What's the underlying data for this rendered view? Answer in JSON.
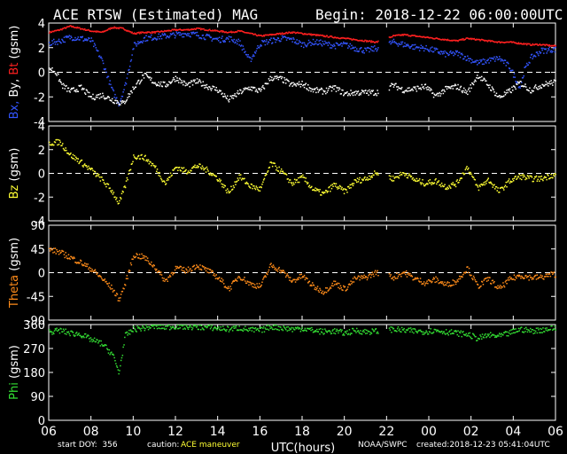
{
  "header": {
    "title": "ACE RTSW (Estimated) MAG",
    "begin": "Begin: 2018-12-22 06:00:00UTC"
  },
  "footer": {
    "start_doy": "start DOY:  356",
    "caution_label": "caution:",
    "caution_text": "ACE maneuver",
    "noaa": "NOAA/SWPC",
    "created": "created:2018-12-23 05:41:04UTC"
  },
  "colors": {
    "bx": "#3355ff",
    "by": "#ffffff",
    "bt": "#ff2020",
    "bz": "#ffff33",
    "theta": "#ff8c1a",
    "phi": "#33dd33"
  },
  "chart_data": [
    {
      "type": "scatter",
      "title": "ACE RTSW (Estimated) MAG",
      "ylabel_parts": [
        {
          "text": "Bx,",
          "color": "bx"
        },
        {
          "text": " By,",
          "color": "by"
        },
        {
          "text": " Bt",
          "color": "bt"
        },
        {
          "text": "  (gsm)",
          "color": "by"
        }
      ],
      "ylim": [
        -4,
        4
      ],
      "yticks": [
        4,
        2,
        0,
        -2,
        -4
      ],
      "series": [
        {
          "name": "Bt",
          "color": "bt",
          "x": [
            0,
            0.5,
            1,
            1.5,
            2,
            2.5,
            3,
            3.5,
            4,
            4.5,
            5,
            5.5,
            6,
            6.5,
            7,
            7.5,
            8,
            8.5,
            9,
            9.5,
            10,
            10.5,
            11,
            11.5,
            12,
            12.5,
            13,
            13.5,
            14,
            14.5,
            15,
            15.5,
            16.3,
            16.8,
            17.3,
            17.8,
            18.3,
            18.8,
            19.3,
            19.8,
            20.3,
            20.8,
            21.3,
            21.8,
            22.3,
            22.8,
            23.3,
            23.8
          ],
          "y": [
            3.3,
            3.5,
            3.8,
            3.6,
            3.4,
            3.3,
            3.7,
            3.6,
            3.2,
            3.3,
            3.3,
            3.4,
            3.5,
            3.5,
            3.6,
            3.5,
            3.4,
            3.3,
            3.4,
            3.2,
            3.0,
            3.1,
            3.2,
            3.3,
            3.2,
            3.1,
            3.0,
            2.9,
            2.8,
            2.7,
            2.6,
            2.5,
            3.0,
            3.1,
            3.0,
            2.9,
            2.8,
            2.7,
            2.6,
            2.8,
            2.7,
            2.6,
            2.5,
            2.5,
            2.4,
            2.3,
            2.3,
            2.2
          ]
        },
        {
          "name": "Bx",
          "color": "bx",
          "x": [
            0,
            0.5,
            1,
            1.5,
            2,
            2.5,
            3,
            3.3,
            3.6,
            4,
            4.5,
            5,
            5.5,
            6,
            6.5,
            7,
            7.5,
            8,
            8.5,
            9,
            9.5,
            10,
            10.5,
            11,
            11.5,
            12,
            12.5,
            13,
            13.5,
            14,
            14.5,
            15,
            15.5,
            16.3,
            16.8,
            17.3,
            17.8,
            18.3,
            18.8,
            19.3,
            19.8,
            20.3,
            20.8,
            21.3,
            21.8,
            22.3,
            22.5,
            22.8,
            23.3,
            23.8
          ],
          "y": [
            2.4,
            2.6,
            2.9,
            2.8,
            2.6,
            1.0,
            -1.5,
            -2.5,
            -1.0,
            2.2,
            2.8,
            2.9,
            3.0,
            3.1,
            3.2,
            3.1,
            2.9,
            2.7,
            2.8,
            2.5,
            1.0,
            2.4,
            2.6,
            2.8,
            2.7,
            2.3,
            2.5,
            2.4,
            2.2,
            2.3,
            2.0,
            1.8,
            2.0,
            2.5,
            2.3,
            2.1,
            2.0,
            1.8,
            1.5,
            1.6,
            1.2,
            0.8,
            1.0,
            1.2,
            0.5,
            -1.2,
            0.2,
            1.2,
            1.8,
            1.9
          ]
        },
        {
          "name": "By",
          "color": "by",
          "x": [
            0,
            0.3,
            0.6,
            1,
            1.5,
            2,
            2.5,
            3,
            3.5,
            4,
            4.5,
            5,
            5.5,
            6,
            6.5,
            7,
            7.5,
            8,
            8.5,
            9,
            9.5,
            10,
            10.5,
            11,
            11.5,
            12,
            12.5,
            13,
            13.5,
            14,
            14.5,
            15,
            15.5,
            16.3,
            16.8,
            17.3,
            17.8,
            18.3,
            18.8,
            19.3,
            19.8,
            20.3,
            20.8,
            21.3,
            21.8,
            22.3,
            22.8,
            23.3,
            23.8
          ],
          "y": [
            0.4,
            0.1,
            -1.0,
            -1.5,
            -1.2,
            -2.0,
            -1.8,
            -2.2,
            -2.5,
            -1.2,
            -0.2,
            -0.8,
            -1.0,
            -0.4,
            -1.0,
            -0.7,
            -1.1,
            -1.4,
            -2.2,
            -1.6,
            -1.2,
            -1.5,
            -0.4,
            -0.5,
            -1.0,
            -0.9,
            -1.4,
            -1.5,
            -1.2,
            -1.7,
            -1.6,
            -1.6,
            -1.6,
            -1.0,
            -1.4,
            -1.3,
            -1.1,
            -1.9,
            -1.3,
            -1.1,
            -1.6,
            -0.2,
            -1.0,
            -2.0,
            -1.5,
            -0.8,
            -1.4,
            -1.0,
            -0.8
          ]
        }
      ]
    },
    {
      "type": "scatter",
      "ylabel_parts": [
        {
          "text": "Bz",
          "color": "bz"
        },
        {
          "text": "  (gsm)",
          "color": "by"
        }
      ],
      "ylim": [
        -4,
        4
      ],
      "yticks": [
        4,
        2,
        0,
        -2,
        -4
      ],
      "series": [
        {
          "name": "Bz",
          "color": "bz",
          "x": [
            0,
            0.5,
            1,
            1.5,
            2,
            2.5,
            3,
            3.3,
            3.6,
            4,
            4.5,
            5,
            5.5,
            6,
            6.5,
            7,
            7.5,
            8,
            8.5,
            9,
            9.5,
            10,
            10.5,
            11,
            11.5,
            12,
            12.5,
            13,
            13.5,
            14,
            14.5,
            15,
            15.5,
            16.3,
            16.8,
            17.3,
            17.8,
            18.3,
            18.8,
            19.3,
            19.8,
            20.3,
            20.8,
            21.3,
            21.8,
            22.3,
            22.8,
            23.3,
            23.8
          ],
          "y": [
            2.6,
            2.7,
            1.6,
            1.0,
            0.3,
            -0.5,
            -1.5,
            -2.5,
            -1.0,
            1.5,
            1.4,
            0.6,
            -0.8,
            0.6,
            0.2,
            0.7,
            0.3,
            -0.4,
            -1.6,
            -0.2,
            -1.0,
            -1.3,
            0.9,
            0.2,
            -0.8,
            -0.3,
            -1.3,
            -1.7,
            -0.9,
            -1.5,
            -0.6,
            -0.4,
            0.1,
            -0.4,
            0.1,
            -0.5,
            -0.8,
            -0.6,
            -1.1,
            -0.8,
            0.6,
            -1.2,
            -0.5,
            -1.5,
            -0.6,
            -0.2,
            -0.4,
            -0.4,
            -0.1
          ]
        }
      ]
    },
    {
      "type": "scatter",
      "ylabel_parts": [
        {
          "text": "Theta",
          "color": "theta"
        },
        {
          "text": "  (gsm)",
          "color": "by"
        }
      ],
      "ylim": [
        -90,
        90
      ],
      "yticks": [
        90,
        45,
        0,
        -45,
        -90
      ],
      "series": [
        {
          "name": "Theta",
          "color": "theta",
          "x": [
            0,
            0.5,
            1,
            1.5,
            2,
            2.5,
            3,
            3.3,
            3.6,
            4,
            4.5,
            5,
            5.5,
            6,
            6.5,
            7,
            7.5,
            8,
            8.5,
            9,
            9.5,
            10,
            10.5,
            11,
            11.5,
            12,
            12.5,
            13,
            13.5,
            14,
            14.5,
            15,
            15.5,
            16.3,
            16.8,
            17.3,
            17.8,
            18.3,
            18.8,
            19.3,
            19.8,
            20.3,
            20.8,
            21.3,
            21.8,
            22.3,
            22.8,
            23.3,
            23.8
          ],
          "y": [
            45,
            40,
            30,
            20,
            8,
            -10,
            -30,
            -50,
            -20,
            35,
            30,
            12,
            -15,
            10,
            5,
            15,
            5,
            -8,
            -30,
            -5,
            -20,
            -25,
            15,
            5,
            -15,
            -5,
            -25,
            -35,
            -18,
            -30,
            -10,
            -8,
            2,
            -8,
            2,
            -10,
            -18,
            -12,
            -22,
            -15,
            10,
            -25,
            -10,
            -30,
            -12,
            -4,
            -8,
            -8,
            -2
          ]
        }
      ]
    },
    {
      "type": "scatter",
      "ylabel_parts": [
        {
          "text": "Phi",
          "color": "phi"
        },
        {
          "text": "  (gsm)",
          "color": "by"
        }
      ],
      "ylim": [
        0,
        360
      ],
      "yticks": [
        360,
        270,
        180,
        90,
        0
      ],
      "xlabel": "UTC(hours)",
      "xticks": [
        "06",
        "08",
        "10",
        "12",
        "14",
        "16",
        "18",
        "20",
        "22",
        "00",
        "02",
        "04",
        "06"
      ],
      "xlim": [
        0,
        24
      ],
      "gap": [
        15.6,
        16.1
      ],
      "series": [
        {
          "name": "Phi",
          "color": "phi",
          "x": [
            0,
            0.5,
            1,
            1.5,
            2,
            2.5,
            3,
            3.3,
            3.6,
            4,
            4.5,
            5,
            5.5,
            6,
            6.5,
            7,
            7.5,
            8,
            8.5,
            9,
            9.5,
            10,
            10.5,
            11,
            11.5,
            12,
            12.5,
            13,
            13.5,
            14,
            14.5,
            15,
            15.5,
            16.3,
            16.8,
            17.3,
            17.8,
            18.3,
            18.8,
            19.3,
            19.8,
            20.3,
            20.8,
            21.3,
            21.8,
            22.3,
            22.8,
            23.3,
            23.8
          ],
          "y": [
            335,
            340,
            330,
            325,
            305,
            290,
            250,
            180,
            320,
            345,
            350,
            355,
            352,
            356,
            354,
            353,
            352,
            348,
            345,
            350,
            342,
            340,
            355,
            350,
            345,
            348,
            340,
            335,
            338,
            330,
            340,
            335,
            337,
            345,
            340,
            338,
            336,
            340,
            335,
            330,
            325,
            310,
            322,
            318,
            330,
            345,
            338,
            342,
            348
          ]
        }
      ]
    }
  ]
}
